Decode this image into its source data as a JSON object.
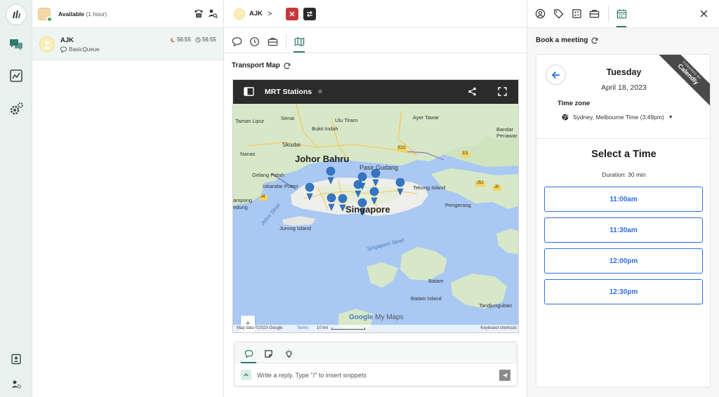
{
  "agent": {
    "status_label": "Available",
    "status_duration": "(1 hour)"
  },
  "conversation": {
    "name": "AJK",
    "queue": "BasicQueue",
    "wait_time": "56:55",
    "total_time": "56:55"
  },
  "header": {
    "contact_name": "AJK"
  },
  "transport_map": {
    "section_title": "Transport Map",
    "map_title": "MRT Stations",
    "labels": {
      "senai": "Senai",
      "ulu_tiram": "Ulu Tiram",
      "ayer_tawar": "Ayer Tawar",
      "taman_lipur": "Taman Lipur",
      "bukit_indah": "Bukit Indah",
      "skudai": "Skudai",
      "bandar_penawar": "Bandar Penawar",
      "johor_bahru": "Johor Bahru",
      "nanas": "Nanas",
      "pasir_gudang": "Pasir Gudang",
      "gelang_patah": "Gelang Patah",
      "iskandar_puteri": "Iskandar Puteri",
      "tekong_island": "Tekong Island",
      "pengerang": "Pengerang",
      "singapore": "Singapore",
      "kampong": "ampong",
      "gedung": "edung",
      "johor_strait": "Johor Strait",
      "jurong_island": "Jurong Island",
      "singapore_strait": "Singapore Strait",
      "batam": "Batam",
      "batam_island": "Batam Island",
      "tandjunguban": "Tandjunguban",
      "sebana": "Sebana",
      "ponggol": "Ponggol"
    },
    "road_badges": [
      "E22",
      "J52",
      "J4",
      "J5",
      "E3"
    ],
    "footer": {
      "attribution": "Map data ©2023 Google",
      "terms": "Terms",
      "scale": "10 km",
      "google": "Google",
      "mymaps": "My Maps",
      "shortcuts": "Keyboard shortcuts"
    },
    "zoom_in": "+",
    "zoom_out": "−"
  },
  "reply": {
    "placeholder": "Write a reply. Type \"/\" to insert snippets"
  },
  "booking": {
    "title": "Book a meeting",
    "day": "Tuesday",
    "date": "April 18, 2023",
    "timezone_label": "Time zone",
    "timezone_value": "Sydney, Melbourne Time (3:49pm)",
    "ribbon_small": "POWERED BY",
    "ribbon_brand": "Calendly",
    "select_title": "Select a Time",
    "duration": "Duration: 30 min",
    "slots": [
      "11:00am",
      "11:30am",
      "12:00pm",
      "12:30pm"
    ]
  },
  "colors": {
    "accent": "#2f7a6a",
    "calendly_blue": "#2c6ee3",
    "close_red": "#c8383a",
    "transfer_dark": "#2b2b2b"
  }
}
